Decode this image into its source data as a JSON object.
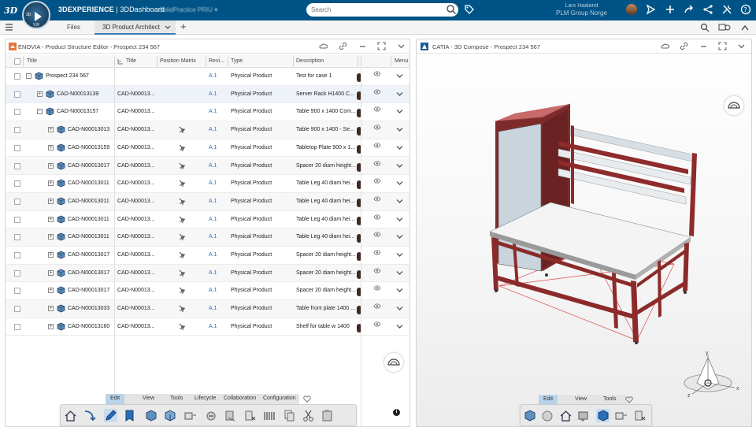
{
  "topbar": {
    "logo_text": "3DS",
    "compass_left": "3D",
    "compass_bottom": "V,R",
    "brand_bold": "3DEXPERIENCE",
    "brand_light": " | 3DDashboard",
    "tenant": "SolidPractice PRIU",
    "search_placeholder": "Search",
    "user_name": "Lars Haaland",
    "user_org": "PLM Group Norge",
    "icons": [
      "search-icon",
      "tag-icon",
      "share-icon",
      "plus-icon",
      "forward-icon",
      "network-icon",
      "tools-icon",
      "help-icon"
    ],
    "bg_color": "#005386"
  },
  "tabbar": {
    "tabs": [
      "Files",
      "3D Product Architect"
    ],
    "active_tab": "3D Product Architect",
    "add_label": "+"
  },
  "left_panel": {
    "title": "ENOVIA - Product Structure Editor - Prospect 234 567",
    "columns": [
      "Title",
      "Title",
      "Position Matrix",
      "Revi...",
      "Type",
      "Description",
      "Menu"
    ],
    "rows": [
      {
        "name": "Prospect 234 567",
        "title2": "",
        "rev": "A.1",
        "type": "Physical Product",
        "desc": "Test for case 1"
      },
      {
        "name": "CAD-N00013139",
        "title2": "CAD-N00013...",
        "rev": "A.1",
        "type": "Physical Product",
        "desc": "Server Rack H1400 C..."
      },
      {
        "name": "CAD-N00013157",
        "title2": "CAD-N00013...",
        "rev": "A.1",
        "type": "Physical Product",
        "desc": "Table 900 x 1400 Com..."
      },
      {
        "name": "CAD-N00013013",
        "title2": "CAD-N00013...",
        "rev": "A.1",
        "type": "Physical Product",
        "desc": "Table 900 x 1400 - Se..."
      },
      {
        "name": "CAD-N00013159",
        "title2": "CAD-N00013...",
        "rev": "A.1",
        "type": "Physical Product",
        "desc": "Tabletop Plate 900 x 1..."
      },
      {
        "name": "CAD-N00013017",
        "title2": "CAD-N00013...",
        "rev": "A.1",
        "type": "Physical Product",
        "desc": "Spacer 20 diam height..."
      },
      {
        "name": "CAD-N00013011",
        "title2": "CAD-N00013...",
        "rev": "A.1",
        "type": "Physical Product",
        "desc": "Table Leg 40 diam hei..."
      },
      {
        "name": "CAD-N00013011",
        "title2": "CAD-N00013...",
        "rev": "A.1",
        "type": "Physical Product",
        "desc": "Table Leg 40 diam hei..."
      },
      {
        "name": "CAD-N00013011",
        "title2": "CAD-N00013...",
        "rev": "A.1",
        "type": "Physical Product",
        "desc": "Table Leg 40 diam hei..."
      },
      {
        "name": "CAD-N00013011",
        "title2": "CAD-N00013...",
        "rev": "A.1",
        "type": "Physical Product",
        "desc": "Table Leg 40 diam hei..."
      },
      {
        "name": "CAD-N00013017",
        "title2": "CAD-N00013...",
        "rev": "A.1",
        "type": "Physical Product",
        "desc": "Spacer 20 diam height..."
      },
      {
        "name": "CAD-N00013017",
        "title2": "CAD-N00013...",
        "rev": "A.1",
        "type": "Physical Product",
        "desc": "Spacer 20 diam height..."
      },
      {
        "name": "CAD-N00013017",
        "title2": "CAD-N00013...",
        "rev": "A.1",
        "type": "Physical Product",
        "desc": "Spacer 20 diam height..."
      },
      {
        "name": "CAD-N00013033",
        "title2": "CAD-N00013...",
        "rev": "A.1",
        "type": "Physical Product",
        "desc": "Table front plate 1400 ..."
      },
      {
        "name": "CAD-N00013160",
        "title2": "CAD-N00013...",
        "rev": "A.1",
        "type": "Physical Product",
        "desc": "Shelf for table w 1400"
      }
    ],
    "tool_tabs": [
      "Edit",
      "View",
      "Tools",
      "Lifecycle",
      "Collaboration",
      "Configuration"
    ],
    "active_tool_tab": "Edit"
  },
  "right_panel": {
    "title": "CATIA - 3D Compose - Prospect 234 567",
    "tool_tabs": [
      "Edit",
      "View",
      "Tools"
    ],
    "active_tool_tab": "Edit",
    "axis_labels": [
      "x",
      "y",
      "z"
    ]
  },
  "colors": {
    "frame_red": "#8c2a2a",
    "accent_blue": "#3a7ab8",
    "link_blue": "#2a6ebb"
  }
}
